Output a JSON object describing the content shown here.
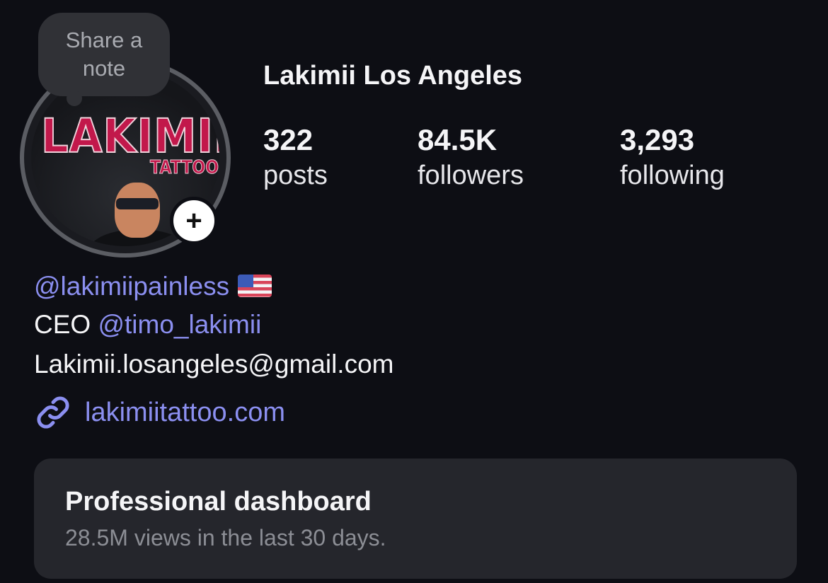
{
  "note": {
    "line1": "Share a",
    "line2": "note"
  },
  "avatar": {
    "logo_text": "LAKIMII",
    "logo_sub": "TATTOO",
    "add_label": "+"
  },
  "profile": {
    "name": "Lakimii Los Angeles"
  },
  "stats": {
    "posts": {
      "count": "322",
      "label": "posts"
    },
    "followers": {
      "count": "84.5K",
      "label": "followers"
    },
    "following": {
      "count": "3,293",
      "label": "following"
    }
  },
  "bio": {
    "handle": "@lakimiipainless",
    "ceo_prefix": "CEO",
    "ceo_mention": "@timo_lakimii",
    "email": "Lakimii.losangeles@gmail.com",
    "website": "lakimiitattoo.com"
  },
  "dashboard": {
    "title": "Professional dashboard",
    "subtitle": "28.5M views in the last 30 days."
  },
  "colors": {
    "background": "#0d0e14",
    "mention": "#8b8ff0",
    "card": "#25262c"
  }
}
